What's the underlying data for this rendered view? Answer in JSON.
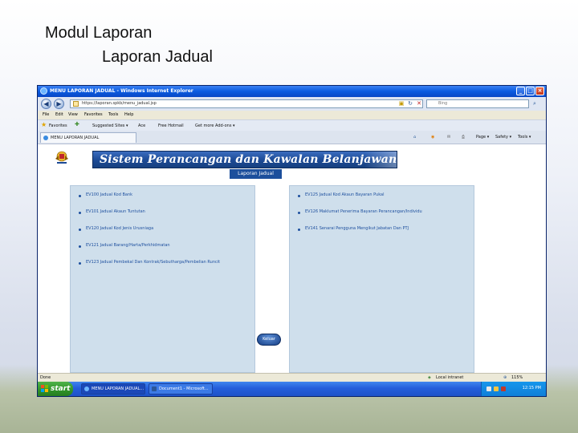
{
  "slide": {
    "title": "Modul Laporan",
    "subtitle": "Laporan Jadual"
  },
  "window": {
    "title": "MENU LAPORAN JADUAL - Windows Internet Explorer",
    "controls": [
      "_",
      "□",
      "×"
    ]
  },
  "address": {
    "url": "https://laporan.spkb/menu_jadual.jsp",
    "search_placeholder": "Bing"
  },
  "menu": [
    "File",
    "Edit",
    "View",
    "Favorites",
    "Tools",
    "Help"
  ],
  "favorites": {
    "label": "Favorites",
    "items": [
      "Suggested Sites ▾",
      "Ace",
      "Free Hotmail",
      "Get more Add-ons ▾"
    ]
  },
  "tab": {
    "label": "MENU LAPORAN JADUAL"
  },
  "commandbar": [
    "Page ▾",
    "Safety ▾",
    "Tools ▾"
  ],
  "page": {
    "banner": "Sistem Perancangan dan Kawalan Belanjawan",
    "section_tab": "Laporan Jadual",
    "left_reports": [
      "EV100 Jadual Kod Bank",
      "EV101 Jadual Akaun Tuntutan",
      "EV120 Jadual Kod Jenis Urusniaga",
      "EV121 Jadual Barang/Harta/Perkhidmatan",
      "EV123 Jadual Pembekal Dan Kontrak/Sebutharga/Pembelian Runcit"
    ],
    "right_reports": [
      "EV125 Jadual Kod Akaun Bayaran Pukal",
      "EV126 Maklumat Penerima Bayaran Perancangan/Individu",
      "EV141 Senarai Pengguna Mengikut Jabatan Dan PTJ"
    ],
    "exit_button": "Keluar"
  },
  "status": {
    "left": "Done",
    "zone": "Local intranet",
    "zoom": "115%"
  },
  "taskbar": {
    "start": "start",
    "tasks": [
      "MENU LAPORAN JADUAL...",
      "Document1 - Microsoft..."
    ],
    "clock": "12:15 PM"
  },
  "colors": {
    "banner": "#1c4a95",
    "panel": "#cfdfec",
    "link": "#1d4f9e",
    "titlebar": "#0a5be0",
    "taskbar": "#245edb",
    "start": "#2f9229"
  }
}
